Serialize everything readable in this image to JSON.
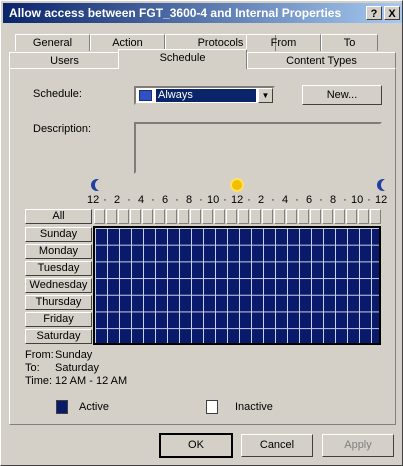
{
  "window": {
    "title": "Allow access between FGT_3600-4 and Internal Properties",
    "help_glyph": "?",
    "close_glyph": "X"
  },
  "tabs_row1": [
    "General",
    "Action",
    "Protocols",
    "From",
    "To"
  ],
  "tabs_row2": [
    "Users",
    "Schedule",
    "Content Types"
  ],
  "selected_tab": "Schedule",
  "schedule": {
    "label": "Schedule:",
    "value": "Always",
    "new_button": "New..."
  },
  "description": {
    "label": "Description:",
    "value": ""
  },
  "grid": {
    "hour_ticks": [
      "12",
      "2",
      "4",
      "6",
      "8",
      "10",
      "12",
      "2",
      "4",
      "6",
      "8",
      "10",
      "12"
    ],
    "all_label": "All",
    "days": [
      "Sunday",
      "Monday",
      "Tuesday",
      "Wednesday",
      "Thursday",
      "Friday",
      "Saturday"
    ],
    "active_fraction": 1.0
  },
  "summary": {
    "from_label": "From:",
    "from_value": "Sunday",
    "to_label": "To:",
    "to_value": "Saturday",
    "time_label": "Time:",
    "time_value": "12 AM - 12 AM"
  },
  "legend": {
    "active": "Active",
    "inactive": "Inactive"
  },
  "buttons": {
    "ok": "OK",
    "cancel": "Cancel",
    "apply": "Apply"
  },
  "colors": {
    "active": "#0a1a6a",
    "title_bar": "#0a246a",
    "dialog_bg": "#d4d0c8"
  }
}
